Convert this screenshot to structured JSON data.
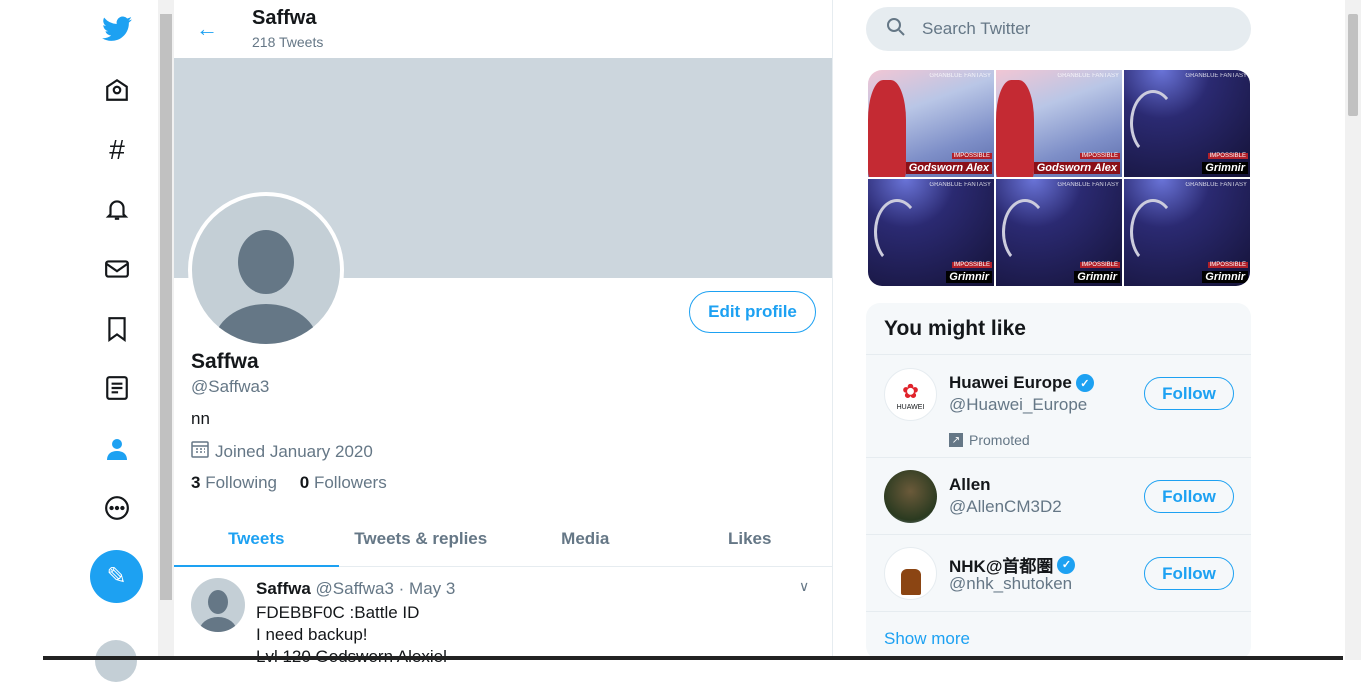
{
  "nav": {
    "items": [
      "twitter-logo",
      "home",
      "explore",
      "notifications",
      "messages",
      "bookmarks",
      "lists",
      "profile",
      "more"
    ]
  },
  "header": {
    "name": "Saffwa",
    "tweet_count": "218 Tweets"
  },
  "profile": {
    "name": "Saffwa",
    "handle": "@Saffwa3",
    "bio": "nn",
    "joined": "Joined January 2020",
    "following_count": "3",
    "following_label": "Following",
    "followers_count": "0",
    "followers_label": "Followers",
    "edit_label": "Edit profile"
  },
  "tabs": [
    {
      "label": "Tweets",
      "active": true
    },
    {
      "label": "Tweets & replies"
    },
    {
      "label": "Media"
    },
    {
      "label": "Likes"
    }
  ],
  "tweet": {
    "name": "Saffwa",
    "handle": "@Saffwa3",
    "date": "· May 3",
    "lines": [
      "FDEBBF0C :Battle ID",
      "I need backup!",
      "Lvl 120 Godsworn Alexiel"
    ]
  },
  "search": {
    "placeholder": "Search Twitter"
  },
  "media": [
    {
      "watermark": "GRANBLUE FANTASY",
      "level": "IMPOSSIBLE",
      "boss": "Godsworn Alex"
    },
    {
      "watermark": "GRANBLUE FANTASY",
      "level": "IMPOSSIBLE",
      "boss": "Godsworn Alex"
    },
    {
      "watermark": "GRANBLUE FANTASY",
      "level": "IMPOSSIBLE",
      "boss": "Grimnir"
    },
    {
      "watermark": "GRANBLUE FANTASY",
      "level": "IMPOSSIBLE",
      "boss": "Grimnir"
    },
    {
      "watermark": "GRANBLUE FANTASY",
      "level": "IMPOSSIBLE",
      "boss": "Grimnir"
    },
    {
      "watermark": "GRANBLUE FANTASY",
      "level": "IMPOSSIBLE",
      "boss": "Grimnir"
    }
  ],
  "wtf": {
    "title": "You might like",
    "show_more": "Show more",
    "follow_label": "Follow",
    "users": [
      {
        "name": "Huawei Europe",
        "handle": "@Huawei_Europe",
        "verified": true,
        "promoted": "Promoted",
        "logo_text": "HUAWEI"
      },
      {
        "name": "Allen",
        "handle": "@AllenCM3D2",
        "verified": false
      },
      {
        "name": "NHK@首都圏",
        "handle": "@nhk_shutoken",
        "verified": true
      }
    ]
  },
  "colors": {
    "accent": "#1da1f2",
    "muted": "#657786",
    "banner": "#ccd6dd"
  }
}
